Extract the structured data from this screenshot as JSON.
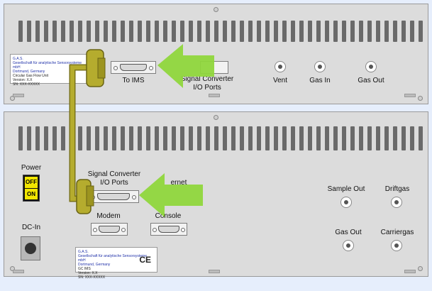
{
  "top_panel": {
    "to_ims_label": "To IMS",
    "signal_converter_label": "Signal Converter\nI/O Ports",
    "vent_label": "Vent",
    "gas_in_label": "Gas In",
    "gas_out_label": "Gas Out",
    "sticker": {
      "brand": "G.A.S.",
      "line1": "Gesellschaft für analytische Sensorsysteme mbH",
      "line2": "Dortmund, Germany",
      "product": "Circular Gas Flow Unit",
      "version": "Version: X.X",
      "serial": "SN: XXX-XXXXX"
    }
  },
  "bottom_panel": {
    "power_label": "Power",
    "off_label": "OFF",
    "on_label": "ON",
    "signal_converter_label": "Signal Converter\nI/O Ports",
    "ethernet_label": "ernet",
    "modem_label": "Modem",
    "console_label": "Console",
    "dc_in_label": "DC-In",
    "sample_out_label": "Sample Out",
    "driftgas_label": "Driftgas",
    "gas_out_label": "Gas Out",
    "carriergas_label": "Carriergas",
    "sticker": {
      "brand": "G.A.S.",
      "line1": "Gesellschaft für analytische Sensorsysteme mbH",
      "line2": "Dortmund, Germany",
      "product": "GC IMS",
      "version": "Version: X.X",
      "serial": "SN: XXX-XXXXX",
      "ce": "CE"
    }
  },
  "colors": {
    "cable": "#b5ac2e",
    "arrow": "#8fd63c",
    "switch": "#f2e600"
  }
}
